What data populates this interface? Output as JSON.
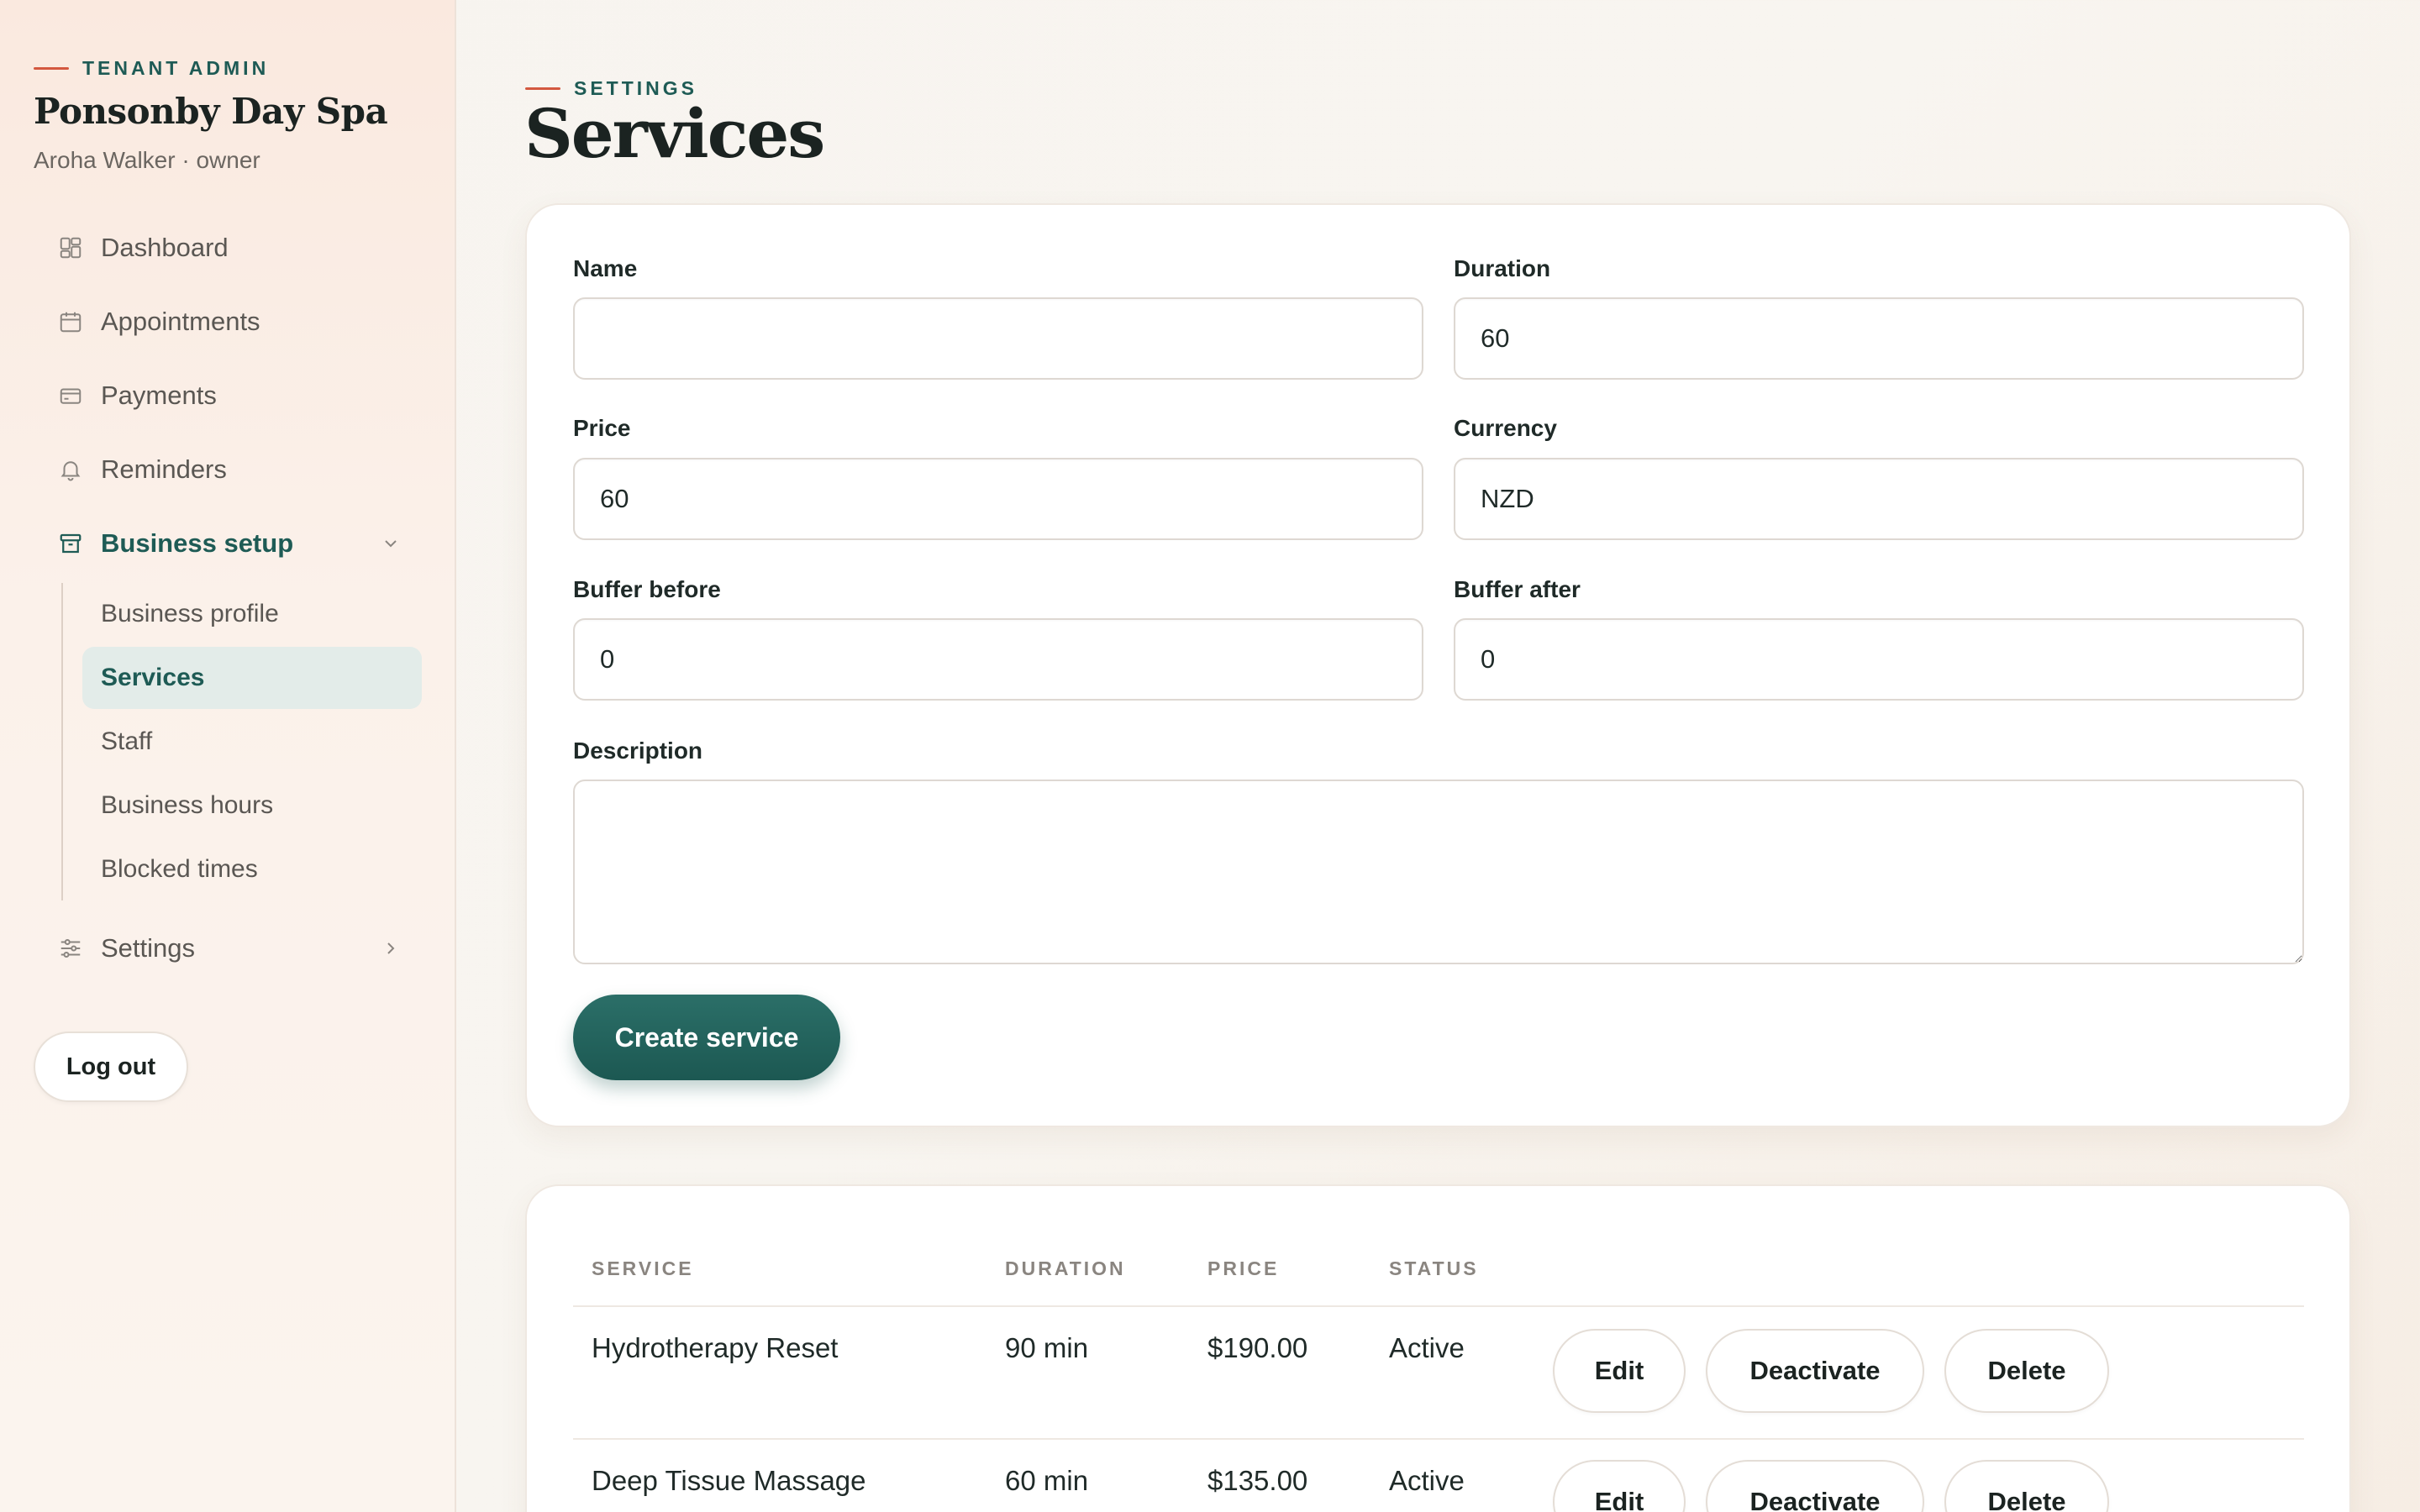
{
  "sidebar": {
    "eyebrow": "TENANT ADMIN",
    "brand": "Ponsonby Day Spa",
    "user": "Aroha Walker · owner",
    "nav": {
      "dashboard": "Dashboard",
      "appointments": "Appointments",
      "payments": "Payments",
      "reminders": "Reminders",
      "business_setup": "Business setup",
      "settings": "Settings"
    },
    "subnav": {
      "business_profile": "Business profile",
      "services": "Services",
      "staff": "Staff",
      "business_hours": "Business hours",
      "blocked_times": "Blocked times"
    },
    "logout": "Log out"
  },
  "header": {
    "eyebrow": "SETTINGS",
    "title": "Services"
  },
  "form": {
    "name_label": "Name",
    "name_value": "",
    "duration_label": "Duration",
    "duration_value": "60",
    "price_label": "Price",
    "price_value": "60",
    "currency_label": "Currency",
    "currency_value": "NZD",
    "buffer_before_label": "Buffer before",
    "buffer_before_value": "0",
    "buffer_after_label": "Buffer after",
    "buffer_after_value": "0",
    "description_label": "Description",
    "description_value": "",
    "submit": "Create service"
  },
  "table": {
    "columns": [
      "SERVICE",
      "DURATION",
      "PRICE",
      "STATUS"
    ],
    "rows": [
      {
        "service": "Hydrotherapy Reset",
        "duration": "90 min",
        "price": "$190.00",
        "status": "Active"
      },
      {
        "service": "Deep Tissue Massage",
        "duration": "60 min",
        "price": "$135.00",
        "status": "Active"
      }
    ],
    "actions": {
      "edit": "Edit",
      "deactivate": "Deactivate",
      "delete": "Delete"
    }
  },
  "colors": {
    "accent": "#1e5b55",
    "eyebrow_dash": "#d3583f",
    "primary_button": "#236760"
  },
  "icons": {
    "dashboard": "grid-icon",
    "appointments": "calendar-icon",
    "payments": "credit-card-icon",
    "reminders": "bell-icon",
    "business_setup": "storefront-icon",
    "settings": "sliders-icon"
  }
}
